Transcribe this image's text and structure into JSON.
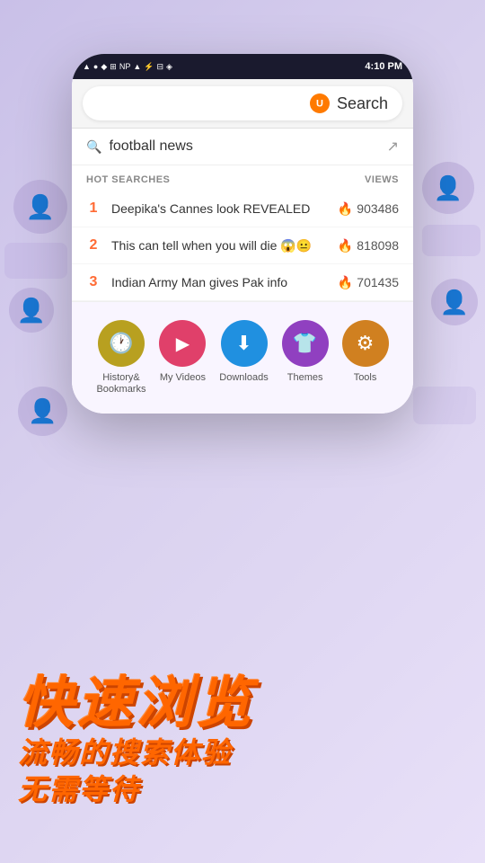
{
  "background": {
    "gradient_start": "#c9c0e8",
    "gradient_end": "#e8e0f8"
  },
  "status_bar": {
    "time": "4:10 PM",
    "icons": [
      "▲",
      "●",
      "◆",
      "⊞",
      "NP",
      "▲",
      "⚡",
      "⊟",
      "◈",
      "▣",
      "▸",
      "⊠",
      "▪"
    ]
  },
  "search_bar": {
    "label": "Search",
    "logo_alt": "UC Browser logo"
  },
  "search_query": {
    "text": "football news",
    "arrow_icon": "↗"
  },
  "hot_searches": {
    "header": "HOT SEARCHES",
    "views_header": "VIEWS",
    "items": [
      {
        "rank": "1",
        "text": "Deepika's Cannes look REVEALED",
        "views": "903486"
      },
      {
        "rank": "2",
        "text": "This can tell when you will die 😱😐",
        "views": "818098"
      },
      {
        "rank": "3",
        "text": "Indian Army Man gives Pak info",
        "views": "701435"
      }
    ]
  },
  "app_icons": [
    {
      "id": "history",
      "label": "History&\nBookmarks",
      "icon": "🕐",
      "color_class": "icon-history"
    },
    {
      "id": "my-videos",
      "label": "My Videos",
      "icon": "▶",
      "color_class": "icon-videos"
    },
    {
      "id": "downloads",
      "label": "Downloads",
      "icon": "⬇",
      "color_class": "icon-downloads"
    },
    {
      "id": "themes",
      "label": "Themes",
      "icon": "👕",
      "color_class": "icon-themes"
    },
    {
      "id": "tools",
      "label": "Tools",
      "icon": "⚙",
      "color_class": "icon-tools"
    }
  ],
  "chinese_text": {
    "title": "快速浏览",
    "subtitle_line1": "流畅的搜索体验",
    "subtitle_line2": "无需等待"
  }
}
